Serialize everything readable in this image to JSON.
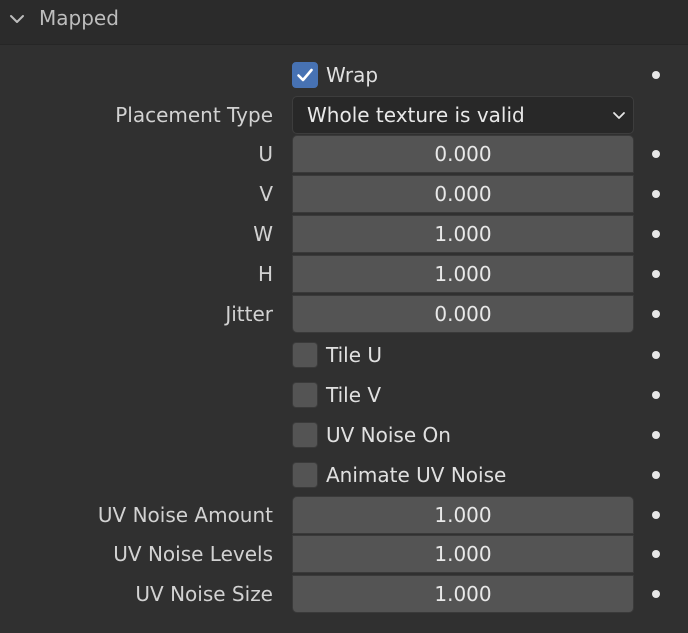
{
  "panel": {
    "title": "Mapped"
  },
  "wrap": {
    "label": "Wrap",
    "checked": true
  },
  "placement_type": {
    "label": "Placement Type",
    "value": "Whole texture is valid"
  },
  "u": {
    "label": "U",
    "value": "0.000"
  },
  "v": {
    "label": "V",
    "value": "0.000"
  },
  "w": {
    "label": "W",
    "value": "1.000"
  },
  "h": {
    "label": "H",
    "value": "1.000"
  },
  "jitter": {
    "label": "Jitter",
    "value": "0.000"
  },
  "tile_u": {
    "label": "Tile U",
    "checked": false
  },
  "tile_v": {
    "label": "Tile V",
    "checked": false
  },
  "uv_noise_on": {
    "label": "UV Noise On",
    "checked": false
  },
  "animate_uv_noise": {
    "label": "Animate UV Noise",
    "checked": false
  },
  "uv_noise_amount": {
    "label": "UV Noise Amount",
    "value": "1.000"
  },
  "uv_noise_levels": {
    "label": "UV Noise Levels",
    "value": "1.000"
  },
  "uv_noise_size": {
    "label": "UV Noise Size",
    "value": "1.000"
  }
}
